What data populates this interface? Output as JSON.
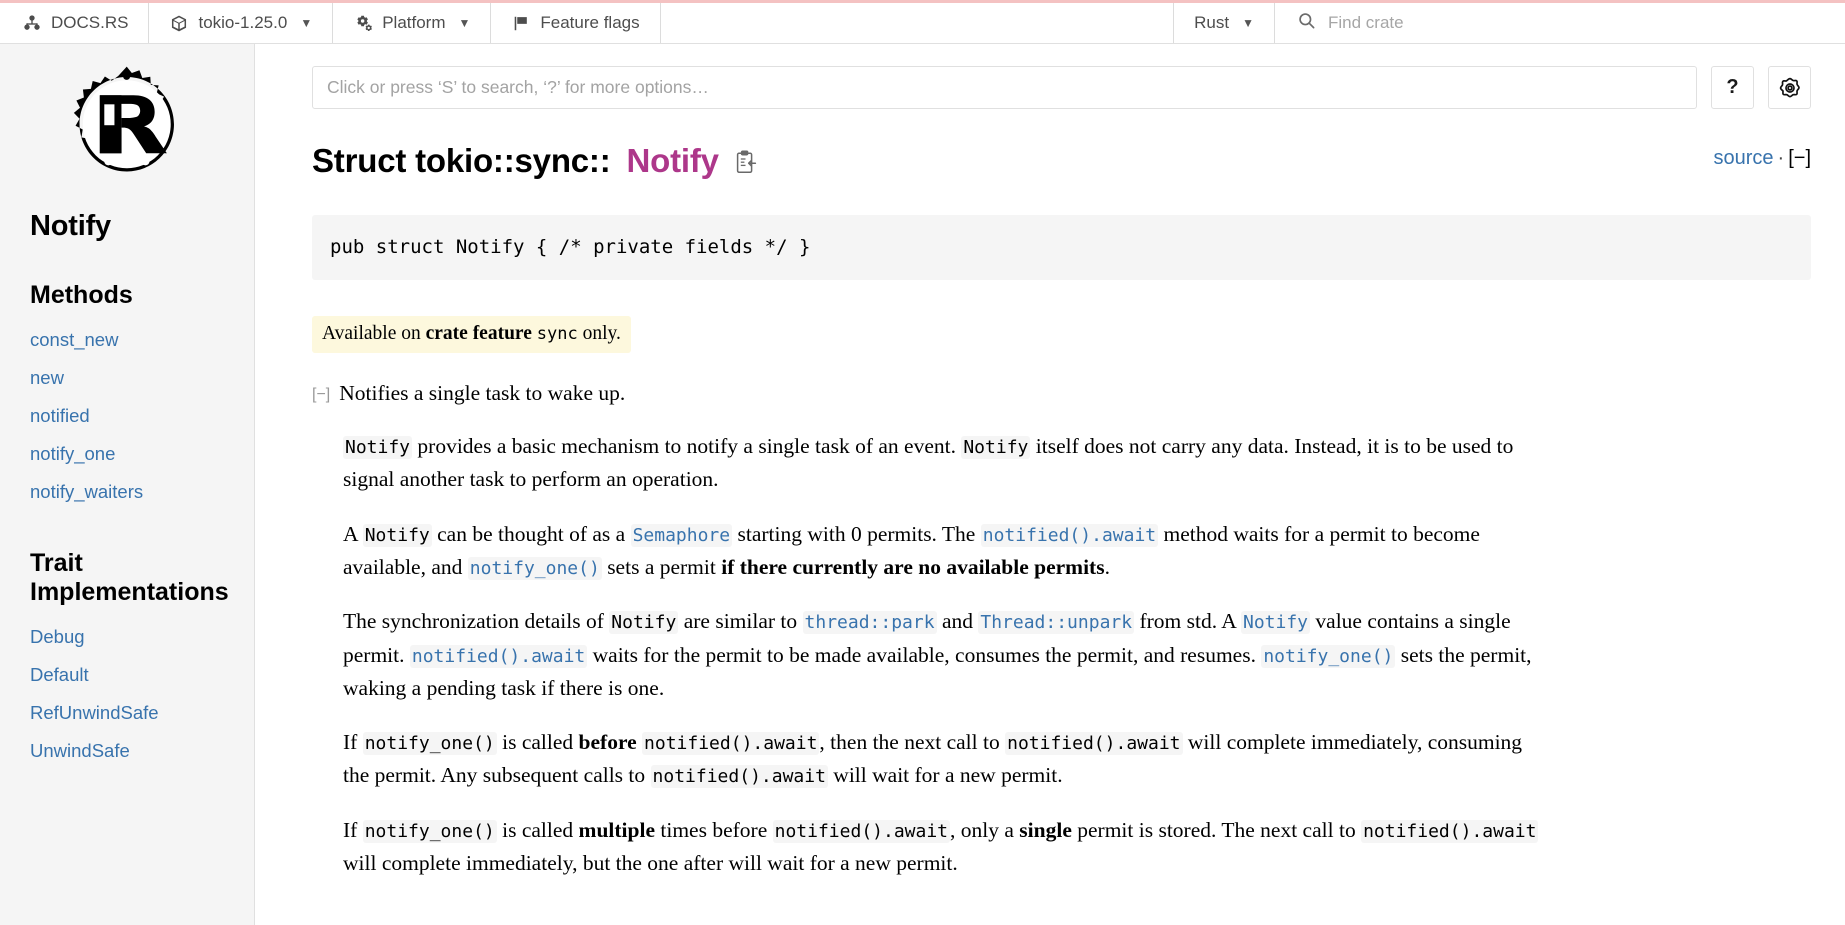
{
  "topnav": {
    "brand": {
      "label": "DOCS.RS",
      "icon": "docsrs-logo-icon"
    },
    "crate": {
      "label": "tokio-1.25.0",
      "icon": "cube-icon",
      "caret": "▼"
    },
    "platform": {
      "label": "Platform",
      "icon": "gears-icon",
      "caret": "▼"
    },
    "feature_flags": {
      "label": "Feature flags",
      "icon": "flag-icon"
    },
    "language": {
      "label": "Rust",
      "caret": "▼"
    },
    "find_crate": {
      "placeholder": "Find crate",
      "icon": "search-icon"
    }
  },
  "sidebar": {
    "logo_alt": "rust-logo",
    "crate_title": "Notify",
    "sections": [
      {
        "title": "Methods",
        "items": [
          {
            "label": "const_new"
          },
          {
            "label": "new"
          },
          {
            "label": "notified"
          },
          {
            "label": "notify_one"
          },
          {
            "label": "notify_waiters"
          }
        ]
      },
      {
        "title": "Trait Implementations",
        "items": [
          {
            "label": "Debug"
          },
          {
            "label": "Default"
          },
          {
            "label": "RefUnwindSafe"
          },
          {
            "label": "UnwindSafe"
          }
        ]
      }
    ]
  },
  "search": {
    "placeholder": "Click or press ‘S’ to search, ‘?’ for more options…",
    "value": "",
    "help_label": "?",
    "settings_icon": "gear-icon"
  },
  "page": {
    "title_prefix": "Struct tokio::sync::",
    "title_name": "Notify",
    "copy_icon": "copy-path-icon",
    "source_link": "source",
    "separator": "·",
    "collapse_toggle": "[−]"
  },
  "declaration": "pub struct Notify { /* private fields */ }",
  "stability": {
    "prefix": "Available on ",
    "bold": "crate feature ",
    "code": "sync",
    "suffix": " only."
  },
  "doc": {
    "toggle": "[−]",
    "summary": "Notifies a single task to wake up.",
    "paragraphs": [
      {
        "id": "p1",
        "parts": [
          {
            "type": "code",
            "text": "Notify"
          },
          {
            "type": "text",
            "text": " provides a basic mechanism to notify a single task of an event. "
          },
          {
            "type": "code",
            "text": "Notify"
          },
          {
            "type": "text",
            "text": " itself does not carry any data. Instead, it is to be used to signal another task to perform an operation."
          }
        ]
      },
      {
        "id": "p2",
        "parts": [
          {
            "type": "text",
            "text": "A "
          },
          {
            "type": "code",
            "text": "Notify"
          },
          {
            "type": "text",
            "text": " can be thought of as a "
          },
          {
            "type": "codelink",
            "text": "Semaphore"
          },
          {
            "type": "text",
            "text": " starting with 0 permits. The "
          },
          {
            "type": "codelink",
            "text": "notified().await"
          },
          {
            "type": "text",
            "text": " method waits for a permit to become available, and "
          },
          {
            "type": "codelink",
            "text": "notify_one()"
          },
          {
            "type": "text",
            "text": " sets a permit "
          },
          {
            "type": "bold",
            "text": "if there currently are no available permits"
          },
          {
            "type": "text",
            "text": "."
          }
        ]
      },
      {
        "id": "p3",
        "parts": [
          {
            "type": "text",
            "text": "The synchronization details of "
          },
          {
            "type": "code",
            "text": "Notify"
          },
          {
            "type": "text",
            "text": " are similar to "
          },
          {
            "type": "codelink",
            "text": "thread::park"
          },
          {
            "type": "text",
            "text": " and "
          },
          {
            "type": "codelink",
            "text": "Thread::unpark"
          },
          {
            "type": "text",
            "text": " from std. A "
          },
          {
            "type": "codelink",
            "text": "Notify"
          },
          {
            "type": "text",
            "text": " value contains a single permit. "
          },
          {
            "type": "codelink",
            "text": "notified().await"
          },
          {
            "type": "text",
            "text": " waits for the permit to be made available, consumes the permit, and resumes. "
          },
          {
            "type": "codelink",
            "text": "notify_one()"
          },
          {
            "type": "text",
            "text": " sets the permit, waking a pending task if there is one."
          }
        ]
      },
      {
        "id": "p4",
        "parts": [
          {
            "type": "text",
            "text": "If "
          },
          {
            "type": "code",
            "text": "notify_one()"
          },
          {
            "type": "text",
            "text": " is called "
          },
          {
            "type": "bold",
            "text": "before"
          },
          {
            "type": "text",
            "text": " "
          },
          {
            "type": "code",
            "text": "notified().await"
          },
          {
            "type": "text",
            "text": ", then the next call to "
          },
          {
            "type": "code",
            "text": "notified().await"
          },
          {
            "type": "text",
            "text": " will complete immediately, consuming the permit. Any subsequent calls to "
          },
          {
            "type": "code",
            "text": "notified().await"
          },
          {
            "type": "text",
            "text": " will wait for a new permit."
          }
        ]
      },
      {
        "id": "p5",
        "parts": [
          {
            "type": "text",
            "text": "If "
          },
          {
            "type": "code",
            "text": "notify_one()"
          },
          {
            "type": "text",
            "text": " is called "
          },
          {
            "type": "bold",
            "text": "multiple"
          },
          {
            "type": "text",
            "text": " times before "
          },
          {
            "type": "code",
            "text": "notified().await"
          },
          {
            "type": "text",
            "text": ", only a "
          },
          {
            "type": "bold",
            "text": "single"
          },
          {
            "type": "text",
            "text": " permit is stored. The next call to "
          },
          {
            "type": "code",
            "text": "notified().await"
          },
          {
            "type": "text",
            "text": " will complete immediately, but the one after will wait for a new permit."
          }
        ]
      }
    ]
  },
  "colors": {
    "link": "#3873ad",
    "type_name": "#ad378a",
    "stab_bg": "#fdf8dd",
    "code_bg": "#f5f5f5",
    "sidebar_bg": "#f5f5f5",
    "accent_top": "#f4c2c2"
  }
}
